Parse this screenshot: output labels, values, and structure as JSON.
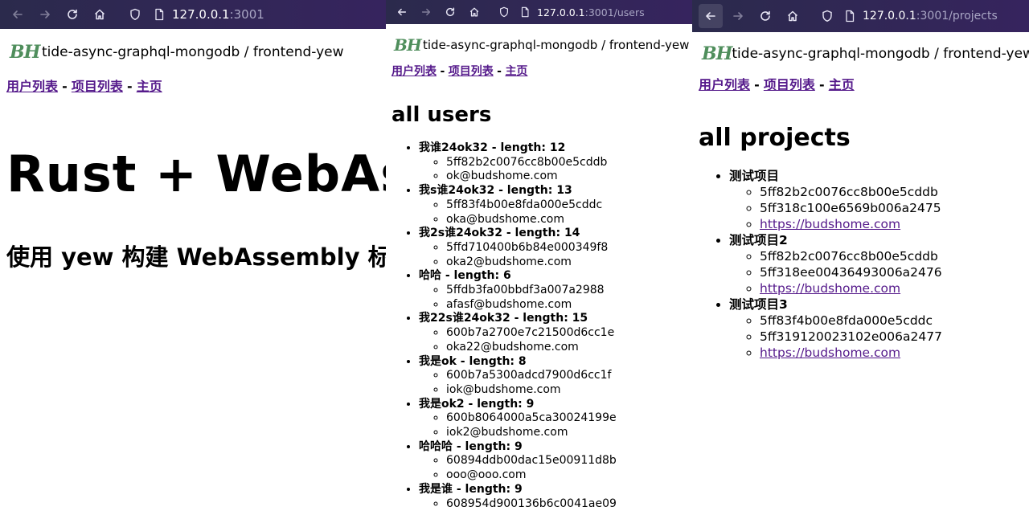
{
  "colors": {
    "toolbar_start": "#2b2a4c",
    "toolbar_end": "#36245e",
    "link_visited": "#551a8b",
    "logo_green": "#4f8e5c"
  },
  "panes": [
    {
      "url_host": "127.0.0.1",
      "url_rest": ":3001",
      "logo_text": "BH",
      "site_title": "tide-async-graphql-mongodb / frontend-yew",
      "nav": {
        "users": "用户列表",
        "projects": "项目列表",
        "home": "主页",
        "sep": "-"
      },
      "heading": "Rust + WebAssembly",
      "subheading": "使用 yew 构建 WebAssembly 标准 web 前端"
    },
    {
      "url_host": "127.0.0.1",
      "url_rest": ":3001/users",
      "logo_text": "BH",
      "site_title": "tide-async-graphql-mongodb / frontend-yew",
      "nav": {
        "users": "用户列表",
        "projects": "项目列表",
        "home": "主页",
        "sep": "-"
      },
      "section_title": "all users",
      "users": [
        {
          "label": "我谁24ok32 - length: 12",
          "id": "5ff82b2c0076cc8b00e5cddb",
          "email": "ok@budshome.com"
        },
        {
          "label": "我s谁24ok32 - length: 13",
          "id": "5ff83f4b00e8fda000e5cddc",
          "email": "oka@budshome.com"
        },
        {
          "label": "我2s谁24ok32 - length: 14",
          "id": "5ffd710400b6b84e000349f8",
          "email": "oka2@budshome.com"
        },
        {
          "label": "哈哈 - length: 6",
          "id": "5ffdb3fa00bbdf3a007a2988",
          "email": "afasf@budshome.com"
        },
        {
          "label": "我22s谁24ok32 - length: 15",
          "id": "600b7a2700e7c21500d6cc1e",
          "email": "oka22@budshome.com"
        },
        {
          "label": "我是ok - length: 8",
          "id": "600b7a5300adcd7900d6cc1f",
          "email": "iok@budshome.com"
        },
        {
          "label": "我是ok2 - length: 9",
          "id": "600b8064000a5ca30024199e",
          "email": "iok2@budshome.com"
        },
        {
          "label": "哈哈哈 - length: 9",
          "id": "60894ddb00dac15e00911d8b",
          "email": "ooo@ooo.com"
        },
        {
          "label": "我是谁 - length: 9",
          "id": "608954d900136b6c0041ae09",
          "email": ""
        }
      ]
    },
    {
      "url_host": "127.0.0.1",
      "url_rest": ":3001/projects",
      "logo_text": "BH",
      "site_title": "tide-async-graphql-mongodb / frontend-yew",
      "nav": {
        "users": "用户列表",
        "projects": "项目列表",
        "home": "主页",
        "sep": "-"
      },
      "section_title": "all projects",
      "projects": [
        {
          "label": "测试项目",
          "user_id": "5ff82b2c0076cc8b00e5cddb",
          "id": "5ff318c100e6569b006a2475",
          "link": "https://budshome.com"
        },
        {
          "label": "测试项目2",
          "user_id": "5ff82b2c0076cc8b00e5cddb",
          "id": "5ff318ee00436493006a2476",
          "link": "https://budshome.com"
        },
        {
          "label": "测试项目3",
          "user_id": "5ff83f4b00e8fda000e5cddc",
          "id": "5ff319120023102e006a2477",
          "link": "https://budshome.com"
        }
      ]
    }
  ]
}
